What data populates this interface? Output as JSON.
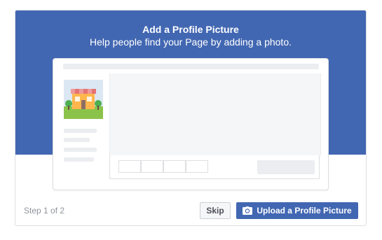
{
  "dialog": {
    "title": "Add a Profile Picture",
    "subtitle": "Help people find your Page by adding a photo."
  },
  "preview": {
    "avatar_icon": "storefront-icon"
  },
  "footer": {
    "step_text": "Step 1 of 2",
    "skip_label": "Skip",
    "upload_label": "Upload a Profile Picture",
    "upload_icon": "camera-icon"
  },
  "colors": {
    "brand_blue": "#4267b2",
    "border": "#dddfe2",
    "placeholder_gray": "#ebedf0",
    "muted_text": "#90949c"
  }
}
